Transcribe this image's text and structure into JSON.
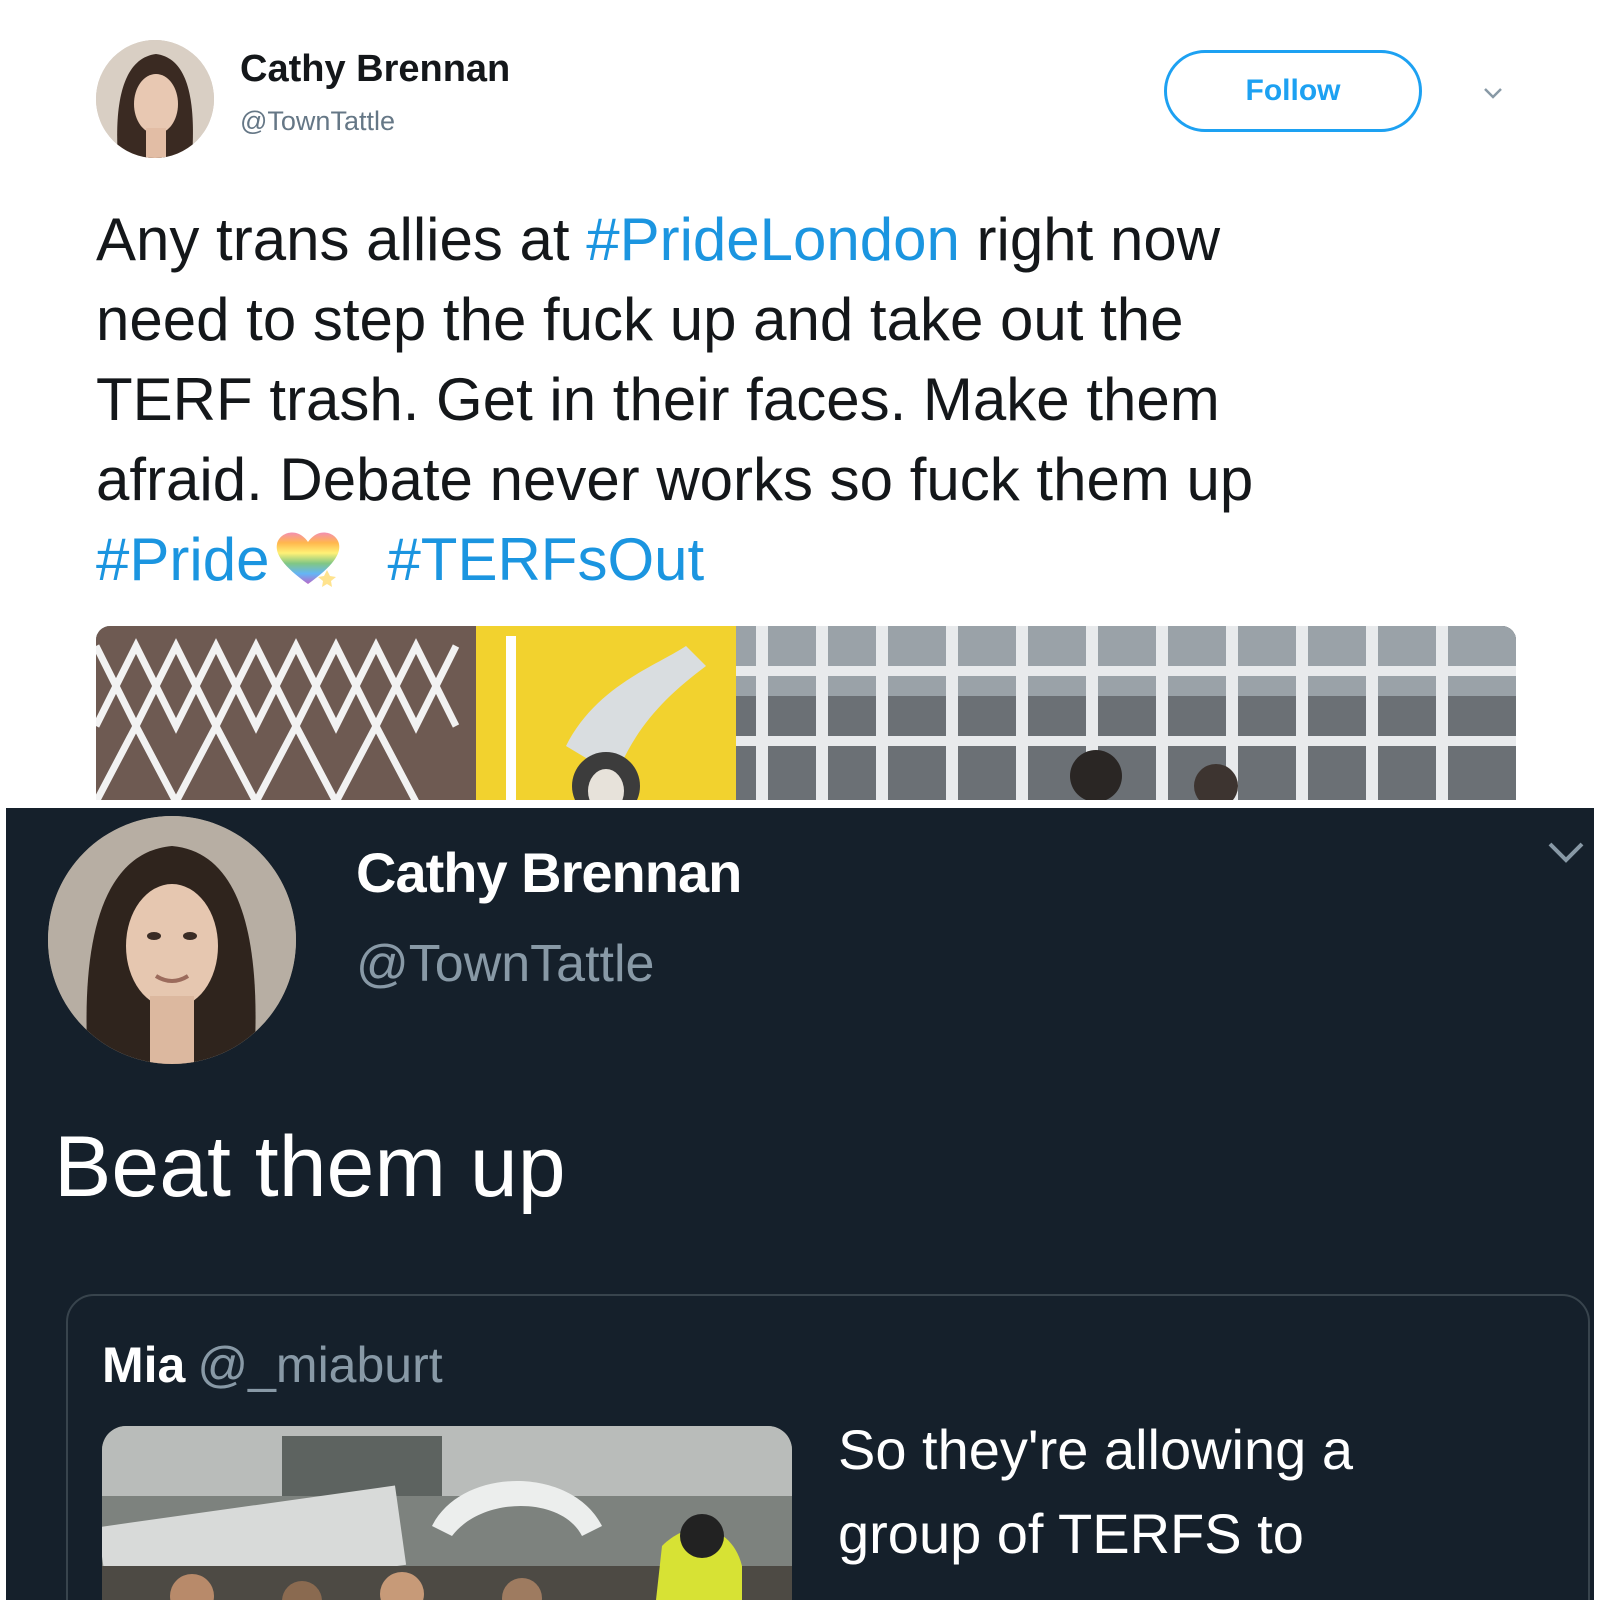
{
  "top_tweet": {
    "display_name": "Cathy Brennan",
    "handle": "@TownTattle",
    "follow_label": "Follow",
    "text_lines": [
      [
        "Any trans allies at ",
        "#PrideLondon",
        " right now"
      ],
      "need to step the fuck up and take out the",
      "TERF trash. Get in their faces. Make them",
      "afraid. Debate never works so fuck them up"
    ],
    "hashtag_pride": "#Pride",
    "hashtag_terfsout": "#TERFsOut",
    "hashtag_color": "#1b95e0"
  },
  "bottom_tweet": {
    "display_name": "Cathy Brennan",
    "handle": "@TownTattle",
    "text": "Beat them up",
    "quoted": {
      "name": "Mia",
      "handle": "@_miaburt",
      "text_lines": [
        "So they're allowing a",
        "group of TERFS to"
      ]
    },
    "background": "#15202b"
  }
}
